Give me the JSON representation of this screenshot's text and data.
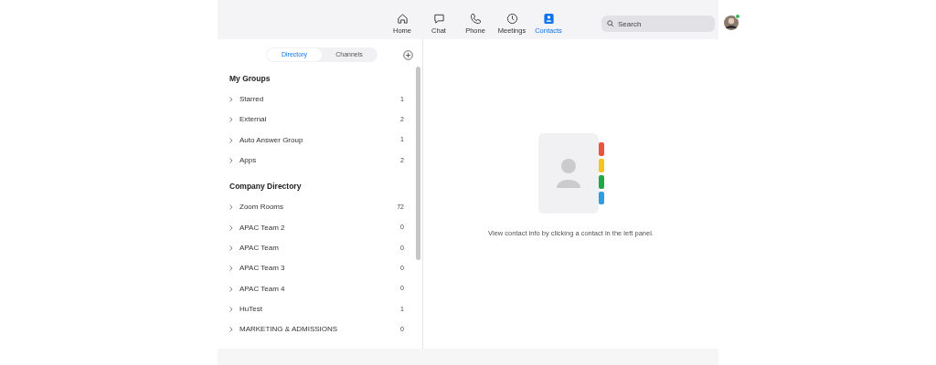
{
  "nav": [
    {
      "label": "Home",
      "selected": false
    },
    {
      "label": "Chat",
      "selected": false
    },
    {
      "label": "Phone",
      "selected": false
    },
    {
      "label": "Meetings",
      "selected": false
    },
    {
      "label": "Contacts",
      "selected": true
    }
  ],
  "search": {
    "placeholder": "Search"
  },
  "segments": [
    {
      "label": "Directory",
      "selected": true
    },
    {
      "label": "Channels",
      "selected": false
    }
  ],
  "sections": [
    {
      "title": "My Groups",
      "items": [
        {
          "label": "Starred",
          "count": "1"
        },
        {
          "label": "External",
          "count": "2"
        },
        {
          "label": "Auto Answer Group",
          "count": "1"
        },
        {
          "label": "Apps",
          "count": "2"
        }
      ]
    },
    {
      "title": "Company Directory",
      "items": [
        {
          "label": "Zoom Rooms",
          "count": "72"
        },
        {
          "label": "APAC Team 2",
          "count": "0"
        },
        {
          "label": "APAC Team",
          "count": "0"
        },
        {
          "label": "APAC Team 3",
          "count": "0"
        },
        {
          "label": "APAC Team 4",
          "count": "0"
        },
        {
          "label": "HuTest",
          "count": "1"
        },
        {
          "label": "MARKETING & ADMISSIONS",
          "count": "0"
        }
      ]
    }
  ],
  "empty_state": {
    "message": "View contact info by clicking a contact in the left panel."
  }
}
